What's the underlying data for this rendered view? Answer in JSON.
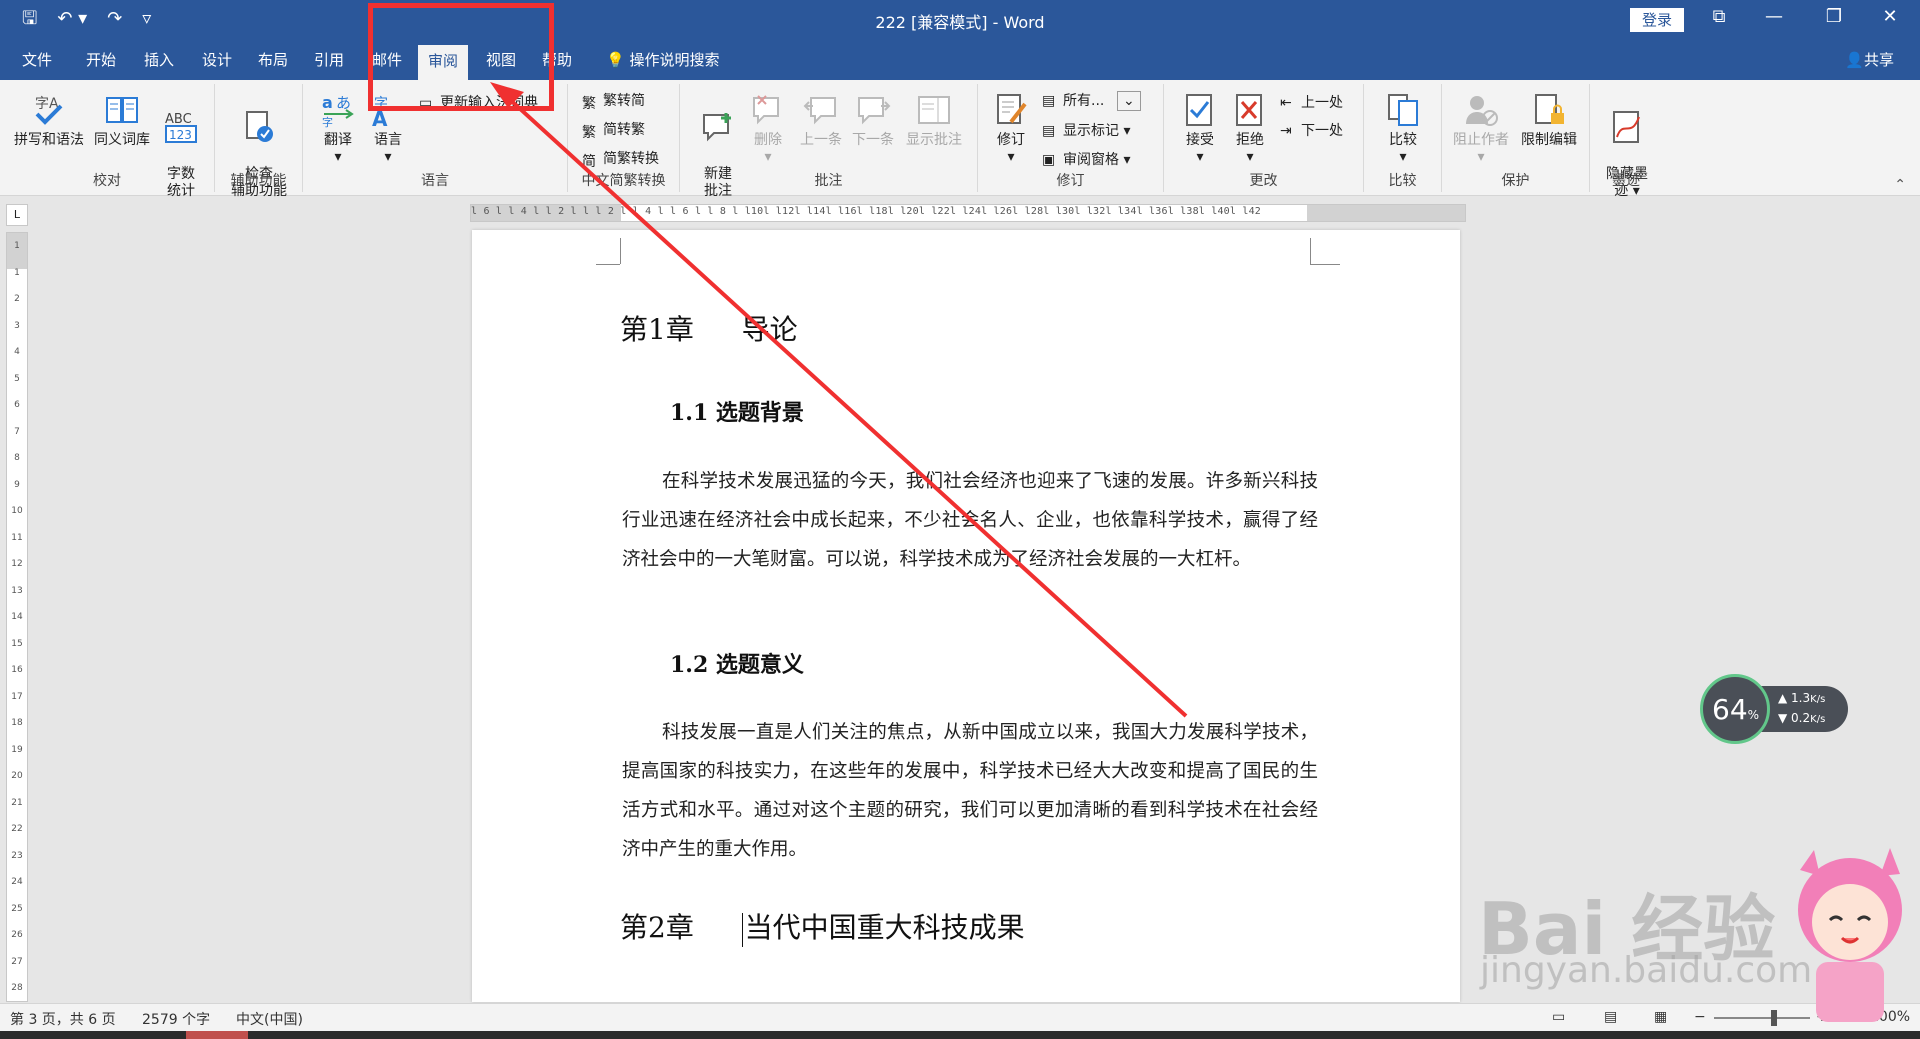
{
  "window": {
    "title": "222 [兼容模式]  -  Word",
    "login_label": "登录",
    "controls": {
      "restore_ribbon": "⧉",
      "minimize": "—",
      "maximize": "❐",
      "close": "✕"
    }
  },
  "qat": {
    "save": "🖫",
    "undo": "↶ ▾",
    "redo": "↷",
    "customize": "▿"
  },
  "tabs": [
    {
      "label": "文件"
    },
    {
      "label": "开始"
    },
    {
      "label": "插入"
    },
    {
      "label": "设计"
    },
    {
      "label": "布局"
    },
    {
      "label": "引用"
    },
    {
      "label": "邮件"
    },
    {
      "label": "审阅"
    },
    {
      "label": "视图"
    },
    {
      "label": "帮助"
    }
  ],
  "tell_me": "操作说明搜索",
  "share_label": "共享",
  "ribbon": {
    "proofing": {
      "label": "校对",
      "spelling": "拼写和语法",
      "thesaurus": "同义词库",
      "wordcount": "字数\n统计"
    },
    "accessibility": {
      "label": "辅助功能",
      "check": "检查\n辅助功能"
    },
    "language": {
      "label": "语言",
      "translate": "翻译",
      "language": "语言",
      "update_ime": "更新输入法词典"
    },
    "chinese": {
      "label": "中文简繁转换",
      "to_simplified": "繁转简",
      "to_traditional": "简转繁",
      "convert": "简繁转换"
    },
    "comments": {
      "label": "批注",
      "new": "新建\n批注",
      "delete": "删除",
      "previous": "上一条",
      "next": "下一条",
      "show": "显示批注"
    },
    "tracking": {
      "label": "修订",
      "track": "修订",
      "all_markup": "所有...",
      "show_markup": "显示标记",
      "review_pane": "审阅窗格"
    },
    "changes": {
      "label": "更改",
      "accept": "接受",
      "reject": "拒绝",
      "previous": "上一处",
      "next": "下一处"
    },
    "compare": {
      "label": "比较",
      "compare": "比较"
    },
    "protect": {
      "label": "保护",
      "block_authors": "阻止作者",
      "restrict": "限制编辑"
    },
    "ink": {
      "label": "墨迹",
      "hide_ink": "隐藏墨\n迹"
    }
  },
  "ruler": {
    "corner": "L",
    "h_ticks": "l 6 l  l 4 l  l 2 l  l     l 2 l  l 4 l  l 6 l  l 8 l  l10l  l12l  l14l  l16l  l18l  l20l  l22l  l24l  l26l  l28l  l30l  l32l  l34l  l36l  l38l  l40l  l42",
    "v_ticks": [
      "1",
      "1",
      "2",
      "3",
      "4",
      "5",
      "6",
      "7",
      "8",
      "9",
      "10",
      "11",
      "12",
      "13",
      "14",
      "15",
      "16",
      "17",
      "18",
      "19",
      "20",
      "21",
      "22",
      "23",
      "24",
      "25",
      "26",
      "27",
      "28"
    ]
  },
  "document": {
    "ch1": {
      "number": "第1章",
      "title": "导论"
    },
    "s1_1": {
      "title": "1.1 选题背景"
    },
    "p1": "在科学技术发展迅猛的今天，我们社会经济也迎来了飞速的发展。许多新兴科技行业迅速在经济社会中成长起来，不少社会名人、企业，也依靠科学技术，赢得了经济社会中的一大笔财富。可以说，科学技术成为了经济社会发展的一大杠杆。",
    "s1_2": {
      "title": "1.2 选题意义"
    },
    "p2": "科技发展一直是人们关注的焦点，从新中国成立以来，我国大力发展科学技术，提高国家的科技实力，在这些年的发展中，科学技术已经大大改变和提高了国民的生活方式和水平。通过对这个主题的研究，我们可以更加清晰的看到科学技术在社会经济中产生的重大作用。",
    "ch2": {
      "number": "第2章",
      "title": "当代中国重大科技成果"
    }
  },
  "status": {
    "page": "第 3 页，共 6 页",
    "words": "2579 个字",
    "language": "中文(中国)",
    "zoom": "100%",
    "zoom_minus": "−",
    "zoom_plus": "+"
  },
  "net_widget": {
    "cpu": "64",
    "cpu_unit": "%",
    "up": "1.3",
    "down": "0.2",
    "unit": "K/s"
  },
  "watermark": {
    "brand": "Bai 经验",
    "url": "jingyan.baidu.com"
  },
  "colors": {
    "accent": "#2b579a",
    "annotation": "#f03030"
  }
}
